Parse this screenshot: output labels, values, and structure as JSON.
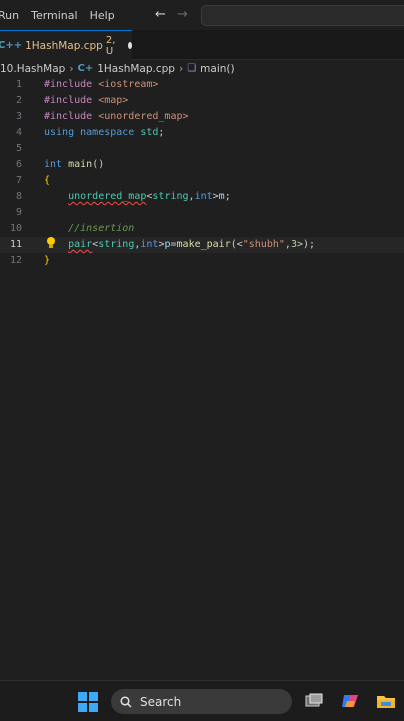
{
  "menubar": {
    "items": [
      "Run",
      "Terminal",
      "Help"
    ]
  },
  "tab": {
    "icon": "C++",
    "label": "1HashMap.cpp",
    "status": "2, U"
  },
  "breadcrumb": {
    "folder": "10.HashMap",
    "file": "1HashMap.cpp",
    "symbol": "main()"
  },
  "editor": {
    "line_numbers": [
      "1",
      "2",
      "3",
      "4",
      "5",
      "6",
      "7",
      "8",
      "9",
      "10",
      "11",
      "12"
    ],
    "active_line": "11"
  },
  "taskbar": {
    "search_label": "Search"
  },
  "colors": {
    "accent": "#0078d4",
    "modified": "#e2c08d",
    "keyword": "#569cd6",
    "preprocessor": "#c586c0",
    "string": "#ce9178",
    "comment": "#6a9955"
  }
}
